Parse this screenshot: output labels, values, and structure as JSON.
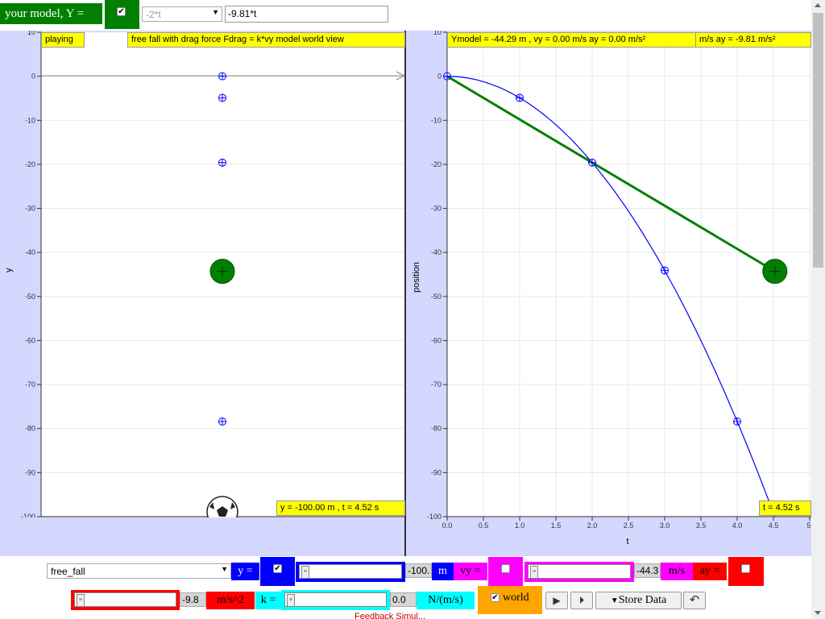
{
  "model_bar": {
    "title": "your model, Y =",
    "checkbox_checked": "✔",
    "select_value": "-2*t",
    "input_value": "-9.81*t"
  },
  "world_panel": {
    "status": "playing",
    "title": "free fall with drag force Fdrag = k*vy model world view",
    "y_axis_label": "y",
    "y_ticks": [
      "10",
      "0",
      "-10",
      "-20",
      "-30",
      "-40",
      "-50",
      "-60",
      "-70",
      "-80",
      "-90",
      "-100"
    ],
    "readout": "y = -100.00 m , t = 4.52 s"
  },
  "graph_panel": {
    "readout_main": "Ymodel = -44.29 m , vy = 0.00 m/s ay = 0.00 m/s²",
    "readout_extra": "m/s ay = -9.81 m/s²",
    "y_axis_label": "position",
    "x_axis_label": "t",
    "y_ticks": [
      "10",
      "0",
      "-10",
      "-20",
      "-30",
      "-40",
      "-50",
      "-60",
      "-70",
      "-80",
      "-90",
      "-100"
    ],
    "x_ticks": [
      "0.0",
      "0.5",
      "1.0",
      "1.5",
      "2.0",
      "2.5",
      "3.0",
      "3.5",
      "4.0",
      "4.5",
      "5."
    ],
    "time_readout": "t = 4.52 s"
  },
  "chart_data": {
    "type": "scatter",
    "xlabel": "t",
    "ylabel": "position",
    "xlim": [
      0,
      5
    ],
    "ylim": [
      -100,
      10
    ],
    "grid": true,
    "points": [
      {
        "t": 0,
        "y": 0
      },
      {
        "t": 1,
        "y": -4.9
      },
      {
        "t": 2,
        "y": -19.6
      },
      {
        "t": 3,
        "y": -44.1
      },
      {
        "t": 4,
        "y": -78.4
      }
    ],
    "model_line": [
      [
        0,
        0
      ],
      [
        4.52,
        -44.29
      ]
    ],
    "current_model": {
      "t": 4.52,
      "y": -44.29
    },
    "colors": {
      "data": "#0000ff",
      "model": "#008000",
      "ball": "#000000"
    }
  },
  "controls": {
    "preset_select": "free_fall",
    "y_label": "y =",
    "y_value": "-100.",
    "y_slider": 0.0,
    "y_unit": "m",
    "vy_label": "vy =",
    "vy_value": "-44.3",
    "vy_slider": 0.0,
    "vy_unit": "m/s",
    "ay_label": "ay =",
    "ay_value": "-9.8",
    "ay_slider": 0.0,
    "ay_unit": "m/s^2",
    "k_label": "k =",
    "k_value": "0.0",
    "k_slider": 0.0,
    "k_unit": "N/(m/s)",
    "world_check": "✔",
    "world_label": "world",
    "store_data_label": "Store Data",
    "play_icon": "▶",
    "step_icon": "⏵",
    "reset_icon": "↶"
  },
  "footer_text": "Feedback Simul..."
}
